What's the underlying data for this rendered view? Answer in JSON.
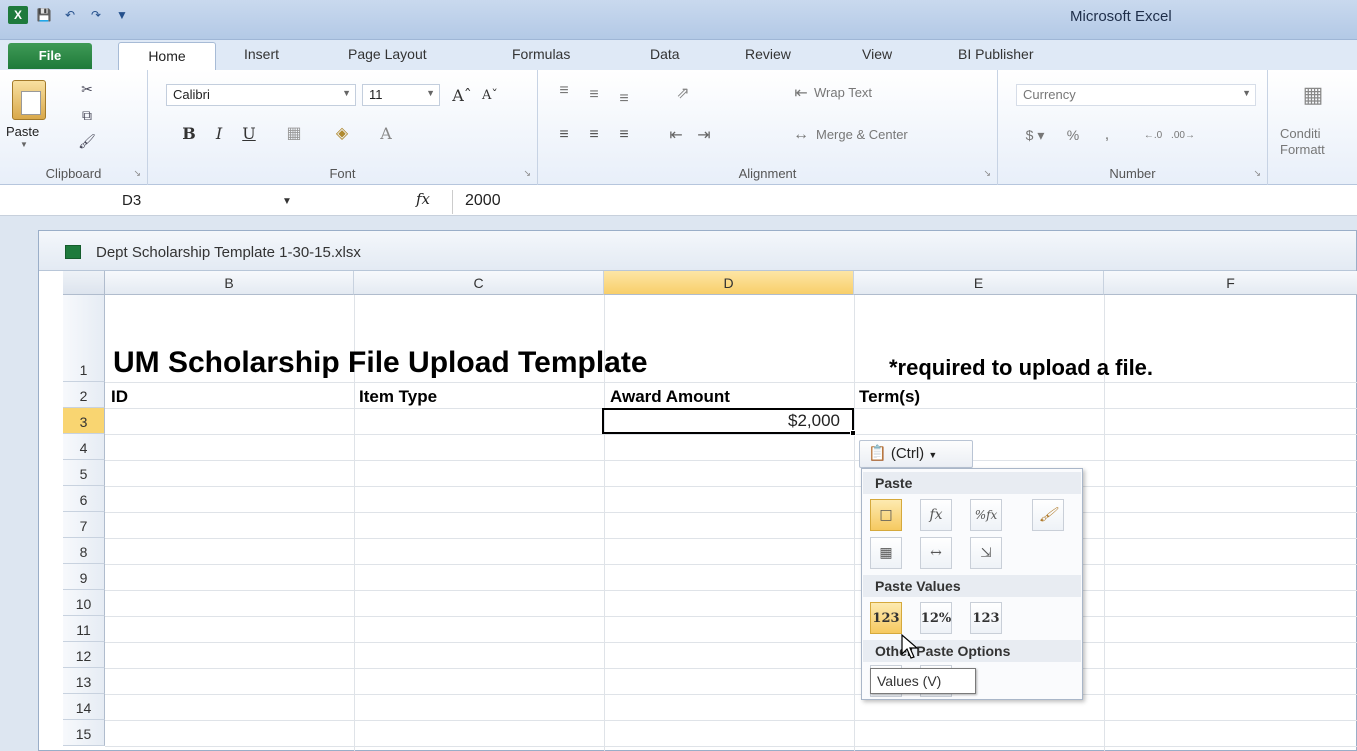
{
  "app": {
    "title": "Microsoft Excel"
  },
  "ribbon_tabs": [
    "File",
    "Home",
    "Insert",
    "Page Layout",
    "Formulas",
    "Data",
    "Review",
    "View",
    "BI Publisher"
  ],
  "ribbon": {
    "clipboard": {
      "paste_label": "Paste",
      "group_label": "Clipboard"
    },
    "font": {
      "font_name": "Calibri",
      "font_size": "11",
      "group_label": "Font"
    },
    "alignment": {
      "wrap_text": "Wrap Text",
      "merge_center": "Merge & Center",
      "group_label": "Alignment"
    },
    "number": {
      "format": "Currency",
      "group_label": "Number"
    },
    "styles": {
      "conditional_line1": "Conditi",
      "conditional_line2": "Formatt"
    }
  },
  "formula_bar": {
    "name_box": "D3",
    "fx_label": "fx",
    "value": "2000"
  },
  "workbook": {
    "filename": "Dept Scholarship Template 1-30-15.xlsx",
    "columns": [
      "B",
      "C",
      "D",
      "E",
      "F"
    ],
    "rows": [
      "1",
      "2",
      "3",
      "4",
      "5",
      "6",
      "7",
      "8",
      "9",
      "10",
      "11",
      "12",
      "13",
      "14",
      "15"
    ],
    "selected_column": "D",
    "selected_row": "3"
  },
  "sheet": {
    "title": "UM Scholarship File Upload Template",
    "required_note": "*required to upload a file.",
    "headers": {
      "id": "ID",
      "item_type": "Item Type",
      "award_amount": "Award Amount",
      "terms": "Term(s)"
    },
    "d3_value": "$2,000"
  },
  "paste_options": {
    "button_label": "(Ctrl)",
    "paste_header": "Paste",
    "paste_values_header": "Paste Values",
    "other_header": "Other Paste Options",
    "tooltip": "Values (V)",
    "value_icon_1": "123",
    "value_icon_2": "12%",
    "value_icon_3": "123"
  }
}
